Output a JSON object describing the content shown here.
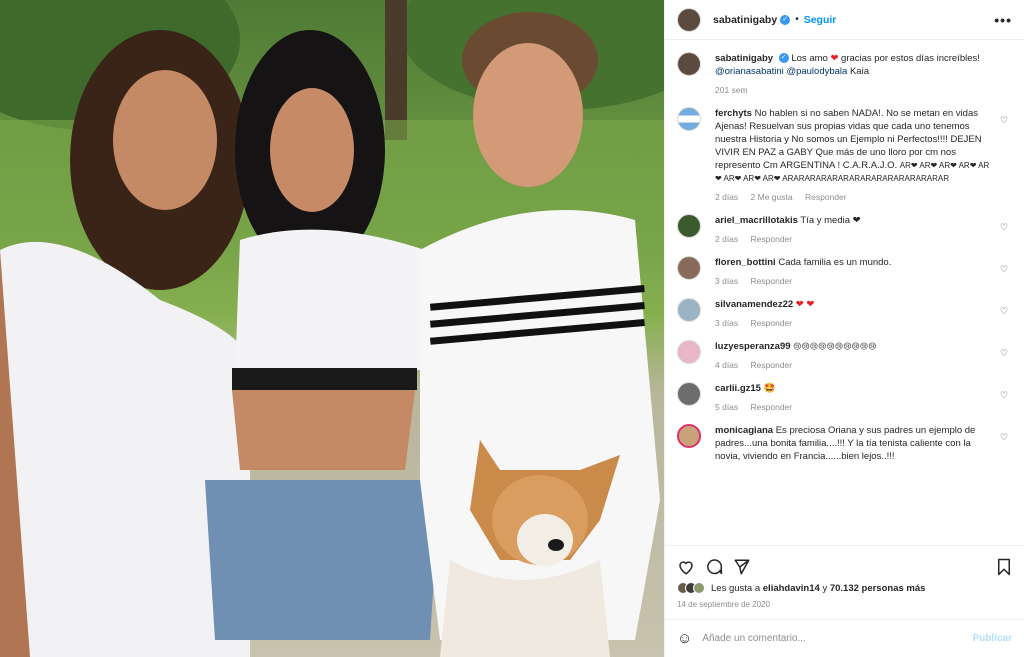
{
  "header": {
    "username": "sabatinigaby",
    "separator": "•",
    "follow_label": "Seguir",
    "more_icon": "more-icon"
  },
  "caption": {
    "username": "sabatinigaby",
    "text_1": "Los amo",
    "text_2": "gracias por estos días increíbles!",
    "mention_1": "@orianasabatini",
    "mention_2": "@paulodybala",
    "text_3": "Kaia",
    "time": "201 sem"
  },
  "comments": [
    {
      "username": "ferchyts",
      "text": "No hablen si no saben NADA!. No se metan en vidas Ajenas! Resuelvan sus propias vidas que cada uno tenemos nuestra Historia y No somos un Ejemplo ni Perfectos!!!! DEJEN VIVIR EN PAZ a GABY Que más de uno lloro por cm nos represento Cm ARGENTINA ! C.A.R.A.J.O.",
      "tail": "AR❤ AR❤ AR❤ AR❤ AR❤ AR❤ AR❤ AR❤ ARARARARARARARARARARARARARARAR",
      "time": "2 días",
      "likes": "2 Me gusta",
      "reply": "Responder"
    },
    {
      "username": "ariel_macrillotakis",
      "text": "Tía y media ❤",
      "time": "2 días",
      "reply": "Responder"
    },
    {
      "username": "floren_bottini",
      "text": "Cada familia es un mundo.",
      "time": "3 días",
      "reply": "Responder"
    },
    {
      "username": "silvanamendez22",
      "text": "❤ ❤",
      "time": "3 días",
      "reply": "Responder"
    },
    {
      "username": "luzyesperanza99",
      "text": "😢😢😢😢😢😢😢😢😢😢",
      "time": "4 días",
      "reply": "Responder"
    },
    {
      "username": "carlii.gz15",
      "text": "🤩",
      "time": "5 días",
      "reply": "Responder"
    },
    {
      "username": "monicagiana",
      "text": "Es preciosa Oriana y sus padres un ejemplo de padres...una bonita familia....!!! Y la tía tenista caliente con la novia, viviendo en Francia......bien lejos..!!!",
      "time": "",
      "reply": ""
    }
  ],
  "likes": {
    "prefix": "Les gusta a",
    "user": "eliahdavin14",
    "middle": "y",
    "count": "70.132 personas más"
  },
  "date": "14 de septiembre de 2020",
  "add_comment": {
    "placeholder": "Añade un comentario...",
    "publish": "Publicar"
  },
  "colors": {
    "accent": "#0095f6",
    "heart": "#ed1c24",
    "muted": "#8e8e8e"
  }
}
